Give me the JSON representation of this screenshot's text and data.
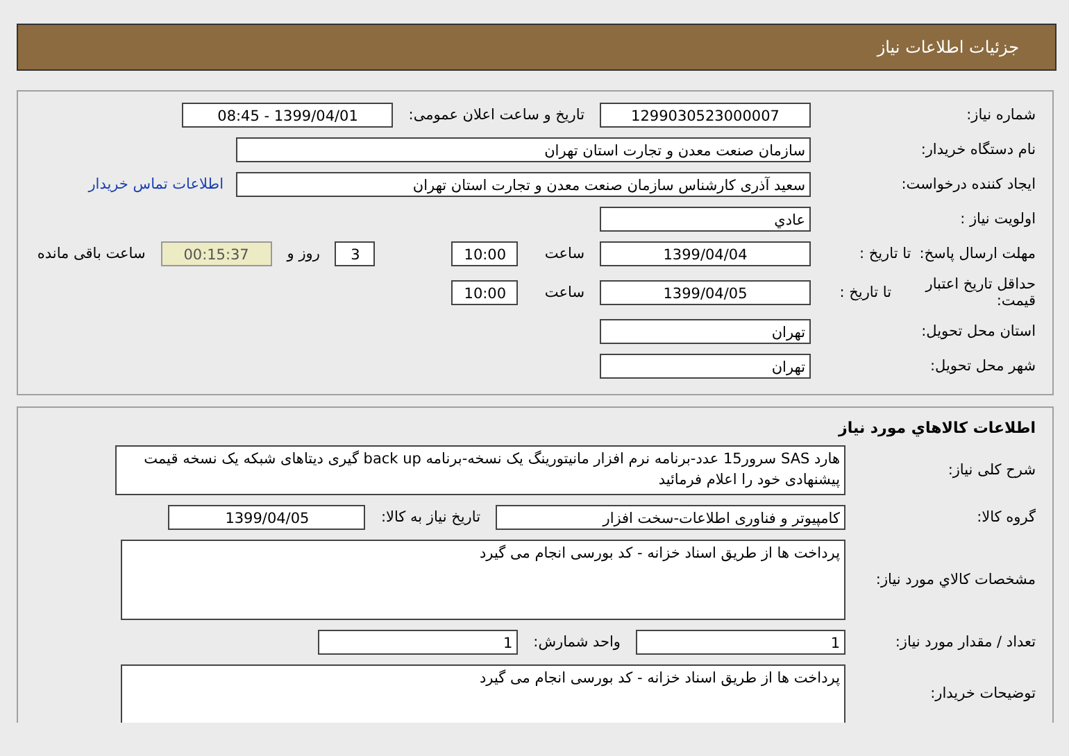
{
  "header": {
    "title": "جزئیات اطلاعات نیاز"
  },
  "details": {
    "rows": [
      {
        "label": "شماره نیاز:",
        "items": [
          {
            "kind": "code",
            "text": "1299030523000007"
          },
          {
            "kind": "text",
            "text": "تاریخ و ساعت اعلان عمومی:"
          },
          {
            "kind": "code",
            "text": "1399/04/01 - 08:45"
          }
        ]
      },
      {
        "label": "نام دستگاه خریدار:",
        "items": [
          {
            "kind": "long",
            "text": "سازمان صنعت معدن و تجارت استان تهران"
          }
        ]
      },
      {
        "label": "ایجاد کننده درخواست:",
        "items": [
          {
            "kind": "long",
            "text": "سعید آذری کارشناس سازمان صنعت معدن و تجارت استان تهران"
          },
          {
            "kind": "link",
            "text": "اطلاعات تماس خریدار"
          }
        ]
      },
      {
        "label": "اولویت نیاز :",
        "items": [
          {
            "kind": "entry",
            "text": "عادي"
          }
        ]
      },
      {
        "label": "مهلت ارسال پاسخ:",
        "sublabel": "تا تاریخ :",
        "items": [
          {
            "kind": "code",
            "text": "1399/04/04"
          },
          {
            "kind": "text",
            "text": "ساعت"
          },
          {
            "kind": "clock",
            "text": "10:00"
          },
          {
            "kind": "count",
            "text": "3"
          },
          {
            "kind": "text",
            "text": "روز و"
          },
          {
            "kind": "timer",
            "text": "00:15:37"
          },
          {
            "kind": "text",
            "text": "ساعت باقی مانده"
          }
        ]
      },
      {
        "label": "حداقل تاریخ اعتبار قیمت:",
        "sublabel": "تا تاریخ :",
        "items": [
          {
            "kind": "code",
            "text": "1399/04/05"
          },
          {
            "kind": "text",
            "text": "ساعت"
          },
          {
            "kind": "clock",
            "text": "10:00"
          }
        ]
      },
      {
        "label": "استان محل تحویل:",
        "items": [
          {
            "kind": "entry",
            "text": "تهران"
          }
        ]
      },
      {
        "label": "شهر محل تحویل:",
        "items": [
          {
            "kind": "entry",
            "text": "تهران"
          }
        ]
      }
    ]
  },
  "goods": {
    "title": "اطلاعات کالاهاي مورد نياز",
    "rows": [
      {
        "label": "شرح کلی نیاز:",
        "items": [
          {
            "kind": "memo",
            "text": "هارد SAS سرور15 عدد-برنامه نرم افزار مانیتورینگ یک نسخه-برنامه back up گیری دیتاهای شبکه یک نسخه قیمت پیشنهادی خود را اعلام فرمائید"
          }
        ]
      },
      {
        "label": "گروه کالا:",
        "items": [
          {
            "kind": "group",
            "text": "کامپیوتر و فناوری اطلاعات-سخت افزار"
          },
          {
            "kind": "text",
            "text": "تاریخ نیاز به کالا:"
          },
          {
            "kind": "date",
            "text": "1399/04/05"
          }
        ]
      },
      {
        "label": "مشخصات کالاي مورد نياز:",
        "items": [
          {
            "kind": "area",
            "text": "پرداخت ها از طریق اسناد خزانه - کد بورسی انجام می گیرد"
          }
        ]
      },
      {
        "label": "تعداد / مقدار مورد نیاز:",
        "items": [
          {
            "kind": "qty",
            "text": "1"
          },
          {
            "kind": "text",
            "text": "واحد شمارش:"
          },
          {
            "kind": "unit",
            "text": "1"
          }
        ]
      },
      {
        "label": "توضیحات خریدار:",
        "items": [
          {
            "kind": "notes",
            "text": "پرداخت ها از طریق اسناد خزانه - کد بورسی انجام می گیرد"
          }
        ]
      }
    ]
  }
}
